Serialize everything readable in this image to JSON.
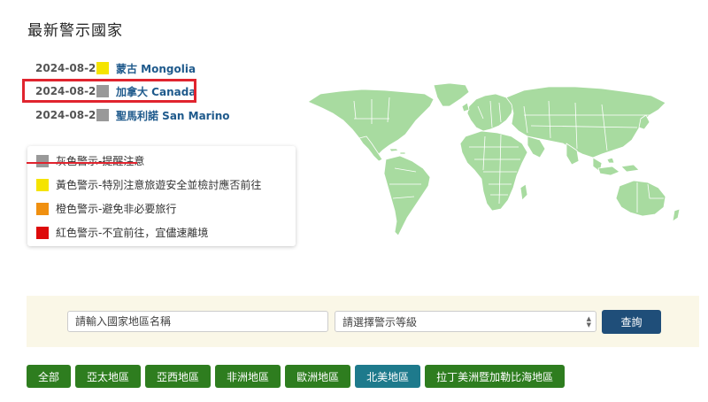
{
  "page_title": "最新警示國家",
  "latest_alerts": [
    {
      "date": "2024-08-21",
      "country": "蒙古 Mongolia",
      "level_color": "#f5e400"
    },
    {
      "date": "2024-08-20",
      "country": "加拿大 Canada",
      "level_color": "#999999"
    },
    {
      "date": "2024-08-20",
      "country": "聖馬利諾 San Marino",
      "level_color": "#999999"
    }
  ],
  "legend": [
    {
      "color": "#999999",
      "label": "灰色警示-提醒注意"
    },
    {
      "color": "#f5e400",
      "label": "黃色警示-特別注意旅遊安全並檢討應否前往"
    },
    {
      "color": "#f09010",
      "label": "橙色警示-避免非必要旅行"
    },
    {
      "color": "#dd0a0a",
      "label": "紅色警示-不宜前往，宜儘速離境"
    }
  ],
  "map": {
    "land_color": "#a8dba0",
    "border_color": "#ffffff"
  },
  "search": {
    "placeholder": "請輸入國家地區名稱",
    "select_value": "請選擇警示等級",
    "query_label": "查詢"
  },
  "regions": [
    {
      "label": "全部",
      "active": false
    },
    {
      "label": "亞太地區",
      "active": false
    },
    {
      "label": "亞西地區",
      "active": false
    },
    {
      "label": "非洲地區",
      "active": false
    },
    {
      "label": "歐洲地區",
      "active": false
    },
    {
      "label": "北美地區",
      "active": true
    },
    {
      "label": "拉丁美洲暨加勒比海地區",
      "active": false
    }
  ],
  "colors": {
    "accent_blue": "#1f4e79",
    "region_green": "#2e7d1f",
    "region_active": "#1e7a8c",
    "highlight_red": "#e0242e",
    "band_bg": "#faf7e7"
  }
}
